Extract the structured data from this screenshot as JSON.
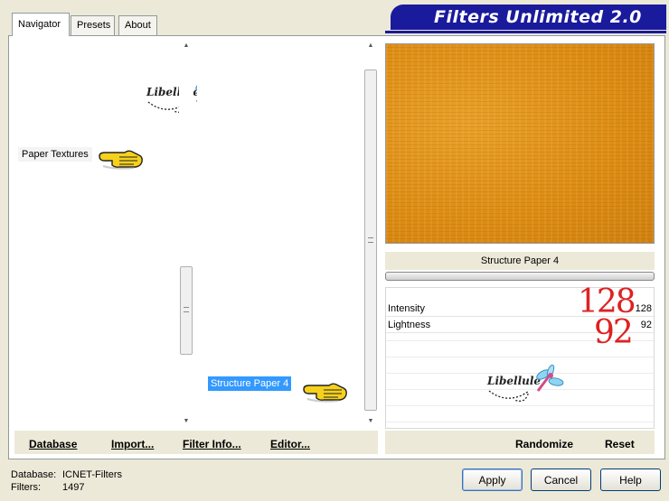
{
  "tabs": [
    {
      "label": "Navigator"
    },
    {
      "label": "Presets"
    },
    {
      "label": "About"
    }
  ],
  "banner": {
    "title": "Filters Unlimited 2.0"
  },
  "categories": {
    "selected_item": "Paper Textures"
  },
  "filters": {
    "selected_item": "Structure Paper 4"
  },
  "watermark": {
    "text": "Libellule"
  },
  "preview": {
    "filter_name": "Structure Paper 4",
    "texture_color": "#dc8c14"
  },
  "params": [
    {
      "label": "Intensity",
      "value": "128"
    },
    {
      "label": "Lightness",
      "value": "92"
    }
  ],
  "annotations": {
    "intensity_big": "128",
    "lightness_big": "92",
    "color": "#dd2222"
  },
  "toolbar_left": {
    "database": "Database",
    "import": "Import...",
    "filter_info": "Filter Info...",
    "editor": "Editor..."
  },
  "toolbar_right": {
    "randomize": "Randomize",
    "reset": "Reset"
  },
  "footer": {
    "database_label": "Database:",
    "database_value": "ICNET-Filters",
    "filters_label": "Filters:",
    "filters_value": "1497"
  },
  "buttons": {
    "apply": "Apply",
    "cancel": "Cancel",
    "help": "Help"
  },
  "icons": [
    "pointing-hand-icon",
    "dragonfly-logo-icon",
    "scroll-up-icon",
    "scroll-down-icon"
  ]
}
